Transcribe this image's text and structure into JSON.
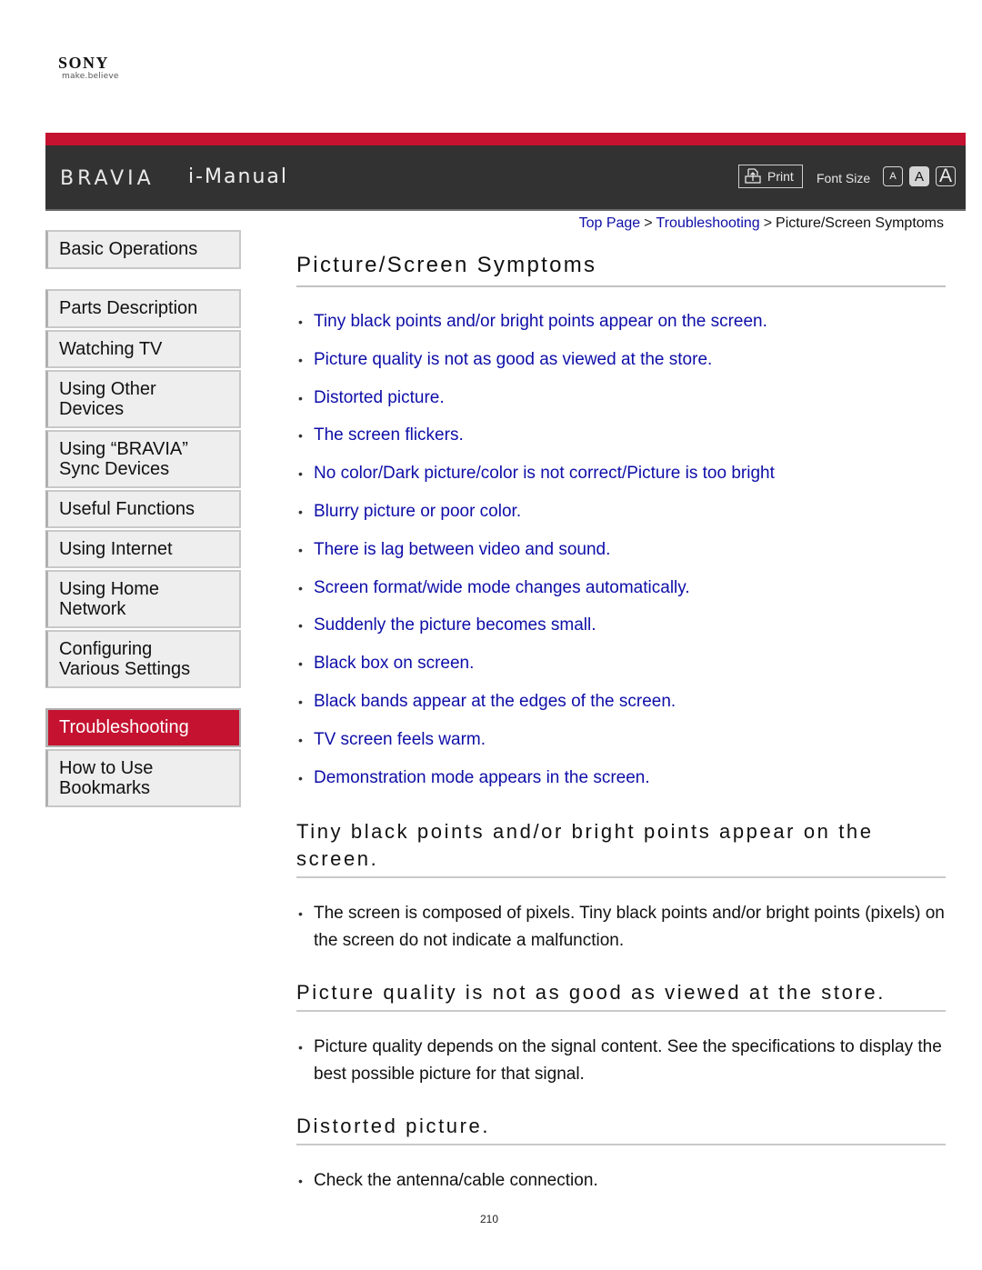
{
  "logo": {
    "brand": "SONY",
    "tagline": "make.believe"
  },
  "header": {
    "product": "BRAVIA",
    "title": "i-Manual",
    "print_label": "Print",
    "font_size_label": "Font Size",
    "font_size_options": [
      "A",
      "A",
      "A"
    ],
    "font_size_selected": "medium",
    "accent_color": "#c41230",
    "bar_color": "#323232"
  },
  "breadcrumb": {
    "items": [
      "Top Page",
      "Troubleshooting"
    ],
    "separator": ">",
    "current": "Picture/Screen Symptoms"
  },
  "sidebar": {
    "items": [
      {
        "label": "Basic Operations"
      },
      {
        "label": "Parts Description"
      },
      {
        "label": "Watching TV"
      },
      {
        "label": "Using Other\nDevices"
      },
      {
        "label": "Using “BRAVIA”\nSync Devices"
      },
      {
        "label": "Useful Functions"
      },
      {
        "label": "Using Internet"
      },
      {
        "label": "Using Home\nNetwork"
      },
      {
        "label": "Configuring\nVarious Settings"
      },
      {
        "label": "Troubleshooting",
        "active": true
      },
      {
        "label": "How to Use\nBookmarks"
      }
    ]
  },
  "main": {
    "title": "Picture/Screen Symptoms",
    "bullet": "•",
    "toc": [
      "Tiny black points and/or bright points appear on the screen.",
      "Picture quality is not as good as viewed at the store.",
      "Distorted picture.",
      "The screen flickers.",
      "No color/Dark picture/color is not correct/Picture is too bright",
      "Blurry picture or poor color.",
      "There is lag between video and sound.",
      "Screen format/wide mode changes automatically.",
      "Suddenly the picture becomes small.",
      "Black box on screen.",
      "Black bands appear at the edges of the screen.",
      "TV screen feels warm.",
      "Demonstration mode appears in the screen."
    ],
    "sections": [
      {
        "title": "Tiny black points and/or bright points appear on the screen.",
        "body": "The screen is composed of pixels. Tiny black points and/or bright points (pixels) on the screen do not indicate a malfunction."
      },
      {
        "title": "Picture quality is not as good as viewed at the store.",
        "body": "Picture quality depends on the signal content. See the specifications to display the best possible picture for that signal."
      },
      {
        "title": "Distorted picture.",
        "body": "Check the antenna/cable connection."
      }
    ],
    "link_color": "#0e0ea8"
  },
  "footer": {
    "page_number": "210"
  }
}
